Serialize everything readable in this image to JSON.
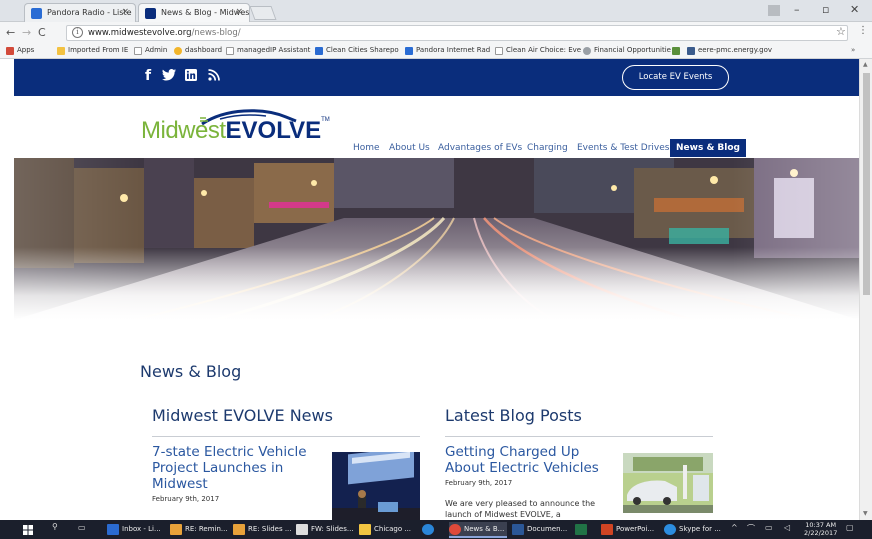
{
  "browser": {
    "tabs": [
      {
        "label": "Pandora Radio - Liste",
        "fav_color": "#2a6cd4"
      },
      {
        "label": "News & Blog - Midwest",
        "fav_color": "#0a2d7c"
      }
    ],
    "url_host": "www.midwestevolve.org",
    "url_path": "/news-blog/",
    "bookmarks": [
      {
        "label": "Apps",
        "color": "#d24a3a"
      },
      {
        "label": "Imported From IE",
        "color": "#f3c242"
      },
      {
        "label": "Admin",
        "color": "#cccccc"
      },
      {
        "label": "dashboard",
        "color": "#f2b52b"
      },
      {
        "label": "managedIP Assistant",
        "color": "#cccccc"
      },
      {
        "label": "Clean Cities Sharepo",
        "color": "#2b6bd1"
      },
      {
        "label": "Pandora Internet Rad",
        "color": "#2a6cd4"
      },
      {
        "label": "Clean Air Choice: Eve",
        "color": "#cccccc"
      },
      {
        "label": "Financial Opportunitie",
        "color": "#9aa0a6"
      },
      {
        "label": "",
        "color": "#5a8f3a"
      },
      {
        "label": "eere-pmc.energy.gov",
        "color": "#3a5b8c"
      }
    ]
  },
  "site": {
    "locate_button": "Locate EV Events",
    "logo_mw": "Midwest",
    "logo_ev": "EVOLVE",
    "logo_tm": "TM",
    "nav": [
      "Home",
      "About Us",
      "Advantages of EVs",
      "Charging",
      "Events & Test Drives",
      "News & Blog"
    ],
    "page_title": "News & Blog",
    "news_col_title": "Midwest EVOLVE News",
    "blog_col_title": "Latest Blog Posts",
    "news_post": {
      "title": "7-state Electric Vehicle Project Launches in Midwest",
      "date": "February 9th, 2017"
    },
    "blog_post": {
      "title": "Getting Charged Up About Electric Vehicles",
      "date": "February 9th, 2017",
      "excerpt": "We are very pleased to announce the launch of Midwest EVOLVE, a partnership"
    }
  },
  "taskbar": {
    "items": [
      {
        "label": "Inbox - Li...",
        "color": "#2b6bd1"
      },
      {
        "label": "RE: Remin...",
        "color": "#e8a23a"
      },
      {
        "label": "RE: Slides ...",
        "color": "#e8a23a"
      },
      {
        "label": "FW: Slides...",
        "color": "#dddddd"
      },
      {
        "label": "Chicago ...",
        "color": "#f2c542"
      },
      {
        "label": "",
        "color": "#2a86d9"
      },
      {
        "label": "News & B...",
        "color": "#e04a3a"
      },
      {
        "label": "Documen...",
        "color": "#2b5797"
      },
      {
        "label": "",
        "color": "#217346"
      },
      {
        "label": "PowerPoi...",
        "color": "#d04423"
      },
      {
        "label": "Skype for ...",
        "color": "#2c8de0"
      }
    ],
    "time": "10:37 AM",
    "date": "2/22/2017"
  }
}
